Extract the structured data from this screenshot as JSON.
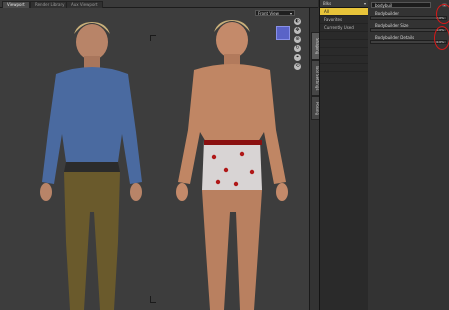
{
  "viewport_tabs": [
    "Viewport",
    "Render Library",
    "Aux Viewport"
  ],
  "view_dropdown": {
    "label": "Front View"
  },
  "side_tabs": [
    "Shaping",
    "Tool Settings",
    "Posing"
  ],
  "categories": {
    "header": "Blks",
    "items": [
      "All",
      "Favorites",
      "Currently Used",
      "",
      "",
      "",
      "",
      ""
    ],
    "selected_index": 0
  },
  "params": {
    "search_value": "bodybuil",
    "items": [
      {
        "label": "Bodybuilder",
        "value": "0.0%",
        "level": 0.0
      },
      {
        "label": "Bodybuilder Size",
        "value": "0.0%",
        "level": 0.0
      },
      {
        "label": "Bodybuilder Details",
        "value": "0.0%",
        "level": 0.0
      }
    ]
  },
  "colors": {
    "selected": "#e8c43a",
    "annotation": "#d81818",
    "viewcube": "#5a63c7"
  }
}
